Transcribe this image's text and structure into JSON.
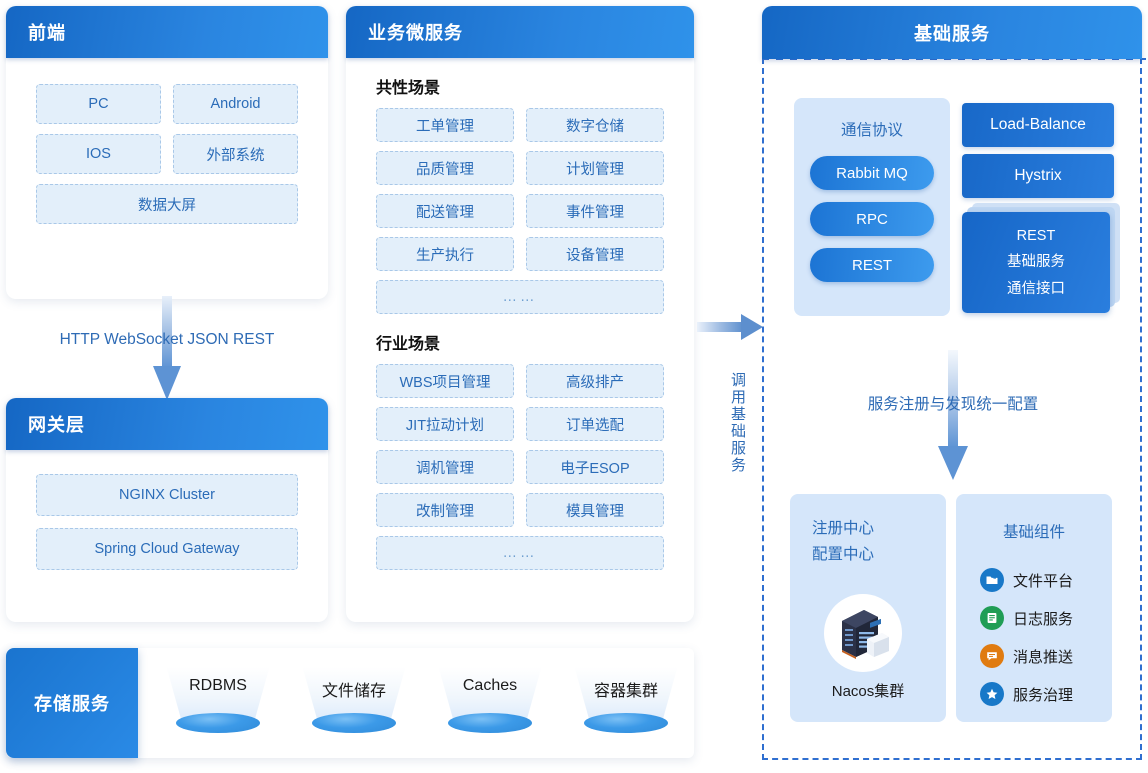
{
  "colors": {
    "header_blue_dark": "#1567c4",
    "header_blue_light": "#2f92ea",
    "tile_bg": "#e3effa",
    "tile_border": "#a9c8e8",
    "tile_text": "#2b6cb8",
    "soft_box_bg": "#d5e6fa",
    "dashed_border": "#2f6fd0",
    "icon_file": "#1878c8",
    "icon_log": "#1f9d55",
    "icon_msg": "#e07b10",
    "icon_gov": "#1878c8"
  },
  "frontend": {
    "title": "前端",
    "items": [
      {
        "label": "PC"
      },
      {
        "label": "Android"
      },
      {
        "label": "IOS"
      },
      {
        "label": "外部系统"
      },
      {
        "label": "数据大屏"
      }
    ]
  },
  "arrow_frontend_gateway": {
    "label": "HTTP WebSocket JSON REST"
  },
  "gateway": {
    "title": "网关层",
    "items": [
      {
        "label": "NGINX Cluster"
      },
      {
        "label": "Spring Cloud Gateway"
      }
    ]
  },
  "storage": {
    "title": "存储服务",
    "items": [
      {
        "label": "RDBMS"
      },
      {
        "label": "文件储存"
      },
      {
        "label": "Caches"
      },
      {
        "label": "容器集群"
      }
    ]
  },
  "microservices": {
    "title": "业务微服务",
    "sections": [
      {
        "heading": "共性场景",
        "items": [
          {
            "label": "工单管理"
          },
          {
            "label": "数字仓储"
          },
          {
            "label": "品质管理"
          },
          {
            "label": "计划管理"
          },
          {
            "label": "配送管理"
          },
          {
            "label": "事件管理"
          },
          {
            "label": "生产执行"
          },
          {
            "label": "设备管理"
          }
        ],
        "more": "……"
      },
      {
        "heading": "行业场景",
        "items": [
          {
            "label": "WBS项目管理"
          },
          {
            "label": "高级排产"
          },
          {
            "label": "JIT拉动计划"
          },
          {
            "label": "订单选配"
          },
          {
            "label": "调机管理"
          },
          {
            "label": "电子ESOP"
          },
          {
            "label": "改制管理"
          },
          {
            "label": "模具管理"
          }
        ],
        "more": "……"
      }
    ]
  },
  "connector_middle_right": {
    "label": "调用基础服务"
  },
  "base_service": {
    "title": "基础服务",
    "protocol_box": {
      "title": "通信协议",
      "pills": [
        {
          "label": "Rabbit MQ"
        },
        {
          "label": "RPC"
        },
        {
          "label": "REST"
        }
      ]
    },
    "right_cards": [
      {
        "label": "Load-Balance"
      },
      {
        "label": "Hystrix"
      }
    ],
    "rest_card": {
      "line1": "REST",
      "line2": "基础服务",
      "line3": "通信接口"
    },
    "registry_arrow_label": "服务注册与发现统一配置",
    "registry_box": {
      "title_line1": "注册中心",
      "title_line2": "配置中心",
      "caption": "Nacos集群"
    },
    "components_box": {
      "title": "基础组件",
      "items": [
        {
          "label": "文件平台",
          "icon": "folder-icon",
          "color": "#1878c8"
        },
        {
          "label": "日志服务",
          "icon": "document-icon",
          "color": "#1f9d55"
        },
        {
          "label": "消息推送",
          "icon": "chat-icon",
          "color": "#e07b10"
        },
        {
          "label": "服务治理",
          "icon": "star-icon",
          "color": "#1878c8"
        }
      ]
    }
  }
}
